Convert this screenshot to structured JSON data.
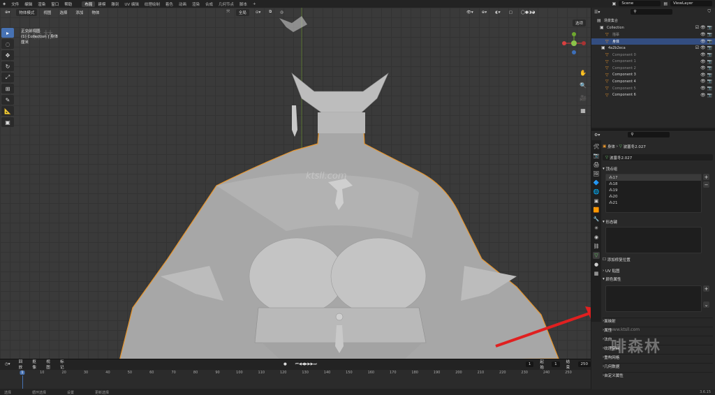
{
  "menu": {
    "items": [
      "文件",
      "编辑",
      "渲染",
      "窗口",
      "帮助"
    ],
    "workspaces": [
      "布局",
      "建模",
      "雕刻",
      "UV 编辑",
      "纹理绘制",
      "着色",
      "动画",
      "渲染",
      "合成",
      "几何节点",
      "脚本"
    ],
    "active_workspace": "布局",
    "scene": "Scene",
    "view_layer": "ViewLayer"
  },
  "viewport": {
    "mode": "物体模式",
    "menus": [
      "视图",
      "选择",
      "添加",
      "物体"
    ],
    "transform": "全局",
    "options_label": "选项",
    "info_line1": "正交前视图",
    "info_line2": "(1) Collection | 身体",
    "info_line3": "厘米",
    "watermark_top": "啡森林",
    "watermark_mid": "ktsll.com"
  },
  "outliner": {
    "scene_collection": "场景集合",
    "collection": "Collection",
    "rows": [
      {
        "name": "描摹",
        "indent": 2,
        "dim": true
      },
      {
        "name": "身体",
        "indent": 2,
        "selected": true
      },
      {
        "name": "4a2b2eca",
        "indent": 1
      },
      {
        "name": "Component 0",
        "indent": 2,
        "dim": true
      },
      {
        "name": "Component 1",
        "indent": 2,
        "dim": true
      },
      {
        "name": "Component 2",
        "indent": 2,
        "dim": true
      },
      {
        "name": "Component 3",
        "indent": 2
      },
      {
        "name": "Component 4",
        "indent": 2
      },
      {
        "name": "Component 5",
        "indent": 2,
        "dim": true
      },
      {
        "name": "Component 6",
        "indent": 2
      }
    ]
  },
  "properties": {
    "breadcrumb_obj": "身体",
    "breadcrumb_mesh": "波塞冬2.027",
    "mesh_name": "波塞冬2.027",
    "vertex_groups_title": "顶点组",
    "vertex_groups": [
      "17",
      "18",
      "19",
      "20",
      "21"
    ],
    "shape_keys_title": "形态键",
    "uv_title": "UV 贴图",
    "color_attr_title": "颜色属性",
    "relative_label": "添加修复位置",
    "sections": [
      "面映射",
      "属性",
      "法向",
      "纹理空间",
      "重构网格",
      "几何数据",
      "自定义属性"
    ],
    "watermark_url": "www.ktsll.com",
    "watermark_brand": "啡森林",
    "version": "3.6.15"
  },
  "timeline": {
    "menus": [
      "回放",
      "抠像",
      "视图",
      "标记"
    ],
    "current_frame": "1",
    "start_label": "起始",
    "start": "1",
    "end_label": "结束",
    "end": "250",
    "ticks": [
      "1",
      "10",
      "20",
      "30",
      "40",
      "50",
      "60",
      "70",
      "80",
      "90",
      "100",
      "110",
      "120",
      "130",
      "140",
      "150",
      "160",
      "170",
      "180",
      "190",
      "200",
      "210",
      "220",
      "230",
      "240",
      "250"
    ]
  },
  "status": {
    "items": [
      "选择",
      "循环选择",
      "设置",
      "更新选择"
    ]
  },
  "colors": {
    "accent": "#4772b3",
    "selection_outline": "#e8962d",
    "highlight_row": "#334d80",
    "arrow": "#e02020"
  }
}
